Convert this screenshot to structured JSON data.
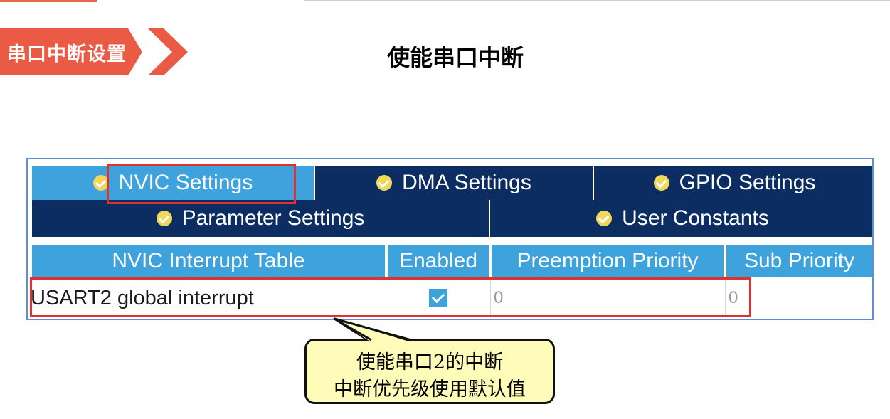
{
  "section_tag": "串口中断设置",
  "slide_title": "使能串口中断",
  "tabs_row1": [
    {
      "label": "NVIC Settings",
      "active": true
    },
    {
      "label": "DMA Settings",
      "active": false
    },
    {
      "label": "GPIO Settings",
      "active": false
    }
  ],
  "tabs_row2": [
    {
      "label": "Parameter Settings"
    },
    {
      "label": "User Constants"
    }
  ],
  "table": {
    "headers": [
      "NVIC Interrupt Table",
      "Enabled",
      "Preemption Priority",
      "Sub Priority"
    ],
    "rows": [
      {
        "name": "USART2 global interrupt",
        "enabled": true,
        "preemption": "0",
        "sub": "0"
      }
    ]
  },
  "callout": {
    "line1": "使能串口2的中断",
    "line2": "中断优先级使用默认值"
  },
  "colors": {
    "tag": "#ea5a44",
    "tab_dark": "#0b2d62",
    "tab_active": "#3ea2dc",
    "highlight": "#e03030",
    "callout_bg": "#fffbb8"
  }
}
